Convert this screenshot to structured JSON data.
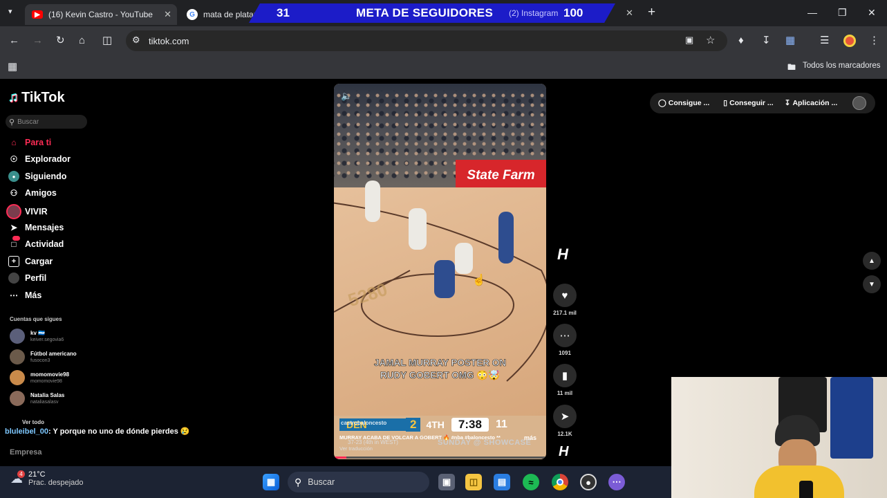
{
  "browser": {
    "tabs": [
      {
        "label": "(16) Kevin Castro - YouTube",
        "icon": "youtube-icon"
      },
      {
        "label": "mata de platano",
        "icon": "google-icon"
      },
      {
        "label": "(2) Instagram",
        "icon": "instagram-icon"
      }
    ],
    "new_tab": "+",
    "url": "tiktok.com",
    "bookmarks_label": "Todos los marcadores"
  },
  "stream_overlay": {
    "current": "31",
    "title": "META DE SEGUIDORES",
    "goal": "100"
  },
  "tiktok": {
    "logo": "TikTok",
    "search_placeholder": "Buscar",
    "nav": [
      {
        "label": "Para ti",
        "icon": "home-icon",
        "active": true
      },
      {
        "label": "Explorador",
        "icon": "compass-icon"
      },
      {
        "label": "Siguiendo",
        "icon": "following-icon"
      },
      {
        "label": "Amigos",
        "icon": "friends-icon"
      },
      {
        "label": "VIVIR",
        "icon": "live-icon"
      },
      {
        "label": "Mensajes",
        "icon": "messages-icon"
      },
      {
        "label": "Actividad",
        "icon": "activity-icon"
      },
      {
        "label": "Cargar",
        "icon": "upload-icon"
      },
      {
        "label": "Perfil",
        "icon": "profile-icon"
      },
      {
        "label": "Más",
        "icon": "more-icon"
      }
    ],
    "following_header": "Cuentas que sigues",
    "following": [
      {
        "name": "kv 🇭🇳",
        "handle": "keiver.segovia6"
      },
      {
        "name": "Fútbol americano",
        "handle": "fusocon3"
      },
      {
        "name": "momomovie98",
        "handle": "momomovie98"
      },
      {
        "name": "Natalia Salas",
        "handle": "nataliasalasv"
      }
    ],
    "see_all": "Ver todo",
    "footer_company": "Empresa",
    "chat_user": "bluleibel_00",
    "chat_message": ": Y porque no uno de dónde pierdes 😢",
    "top_actions": [
      "Consigue ...",
      "Conseguir ...",
      "Aplicación ..."
    ],
    "video": {
      "caption_line1": "JAMAL MURRAY POSTER ON",
      "caption_line2": "RUDY GOBERT OMG 😳🤯",
      "score_team": "DEN",
      "score_pts": "2",
      "quarter": "4TH",
      "clock": "7:38",
      "shot": "11",
      "record": "37-23 (4th in WEST)",
      "network": "SUNDAY @ SHOWCASE",
      "author": "castrobaloncesto",
      "description": "MURRAY ACABA DE VOLCAR A GOBERT 🔥 #nba #baloncesto **",
      "more": "más",
      "translate": "Ver traducción",
      "court_ad": "State Farm"
    },
    "actions": [
      {
        "icon": "heart-icon",
        "count": "217.1 mil"
      },
      {
        "icon": "comment-icon",
        "count": "1091"
      },
      {
        "icon": "bookmark-icon",
        "count": "11 mil"
      },
      {
        "icon": "share-icon",
        "count": "12.1K"
      }
    ]
  },
  "taskbar": {
    "weather_temp": "21°C",
    "weather_desc": "Prac. despejado",
    "weather_badge": "4",
    "search_placeholder": "Buscar"
  }
}
